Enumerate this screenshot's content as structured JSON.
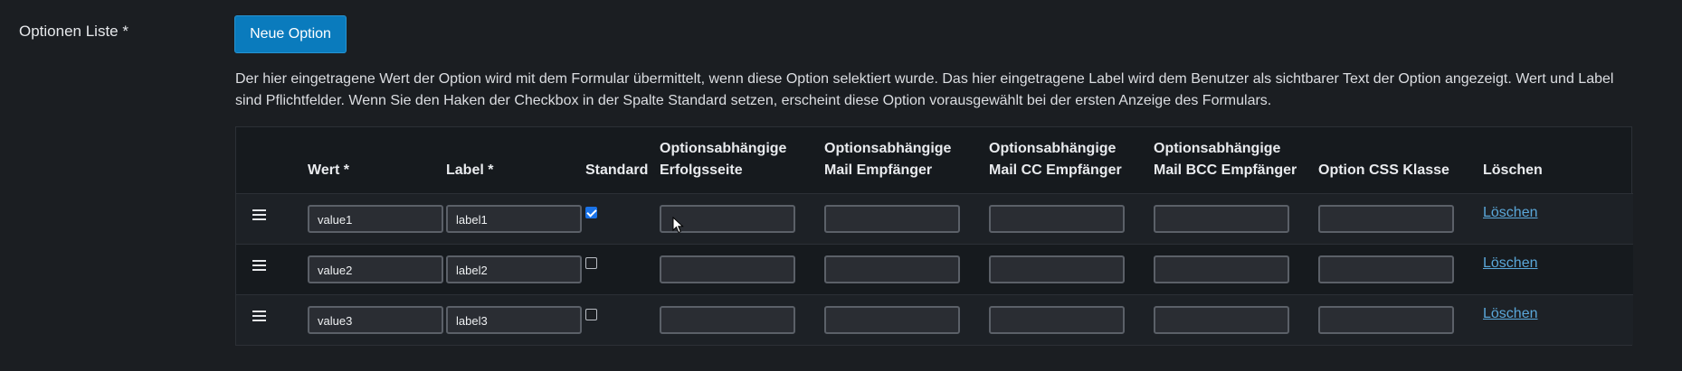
{
  "field": {
    "label": "Optionen Liste *",
    "new_button": "Neue Option",
    "description": "Der hier eingetragene Wert der Option wird mit dem Formular übermittelt, wenn diese Option selektiert wurde. Das hier eingetragene Label wird dem Benutzer als sichtbarer Text der Option angezeigt. Wert und Label sind Pflichtfelder. Wenn Sie den Haken der Checkbox in der Spalte Standard setzen, erscheint diese Option vorausgewählt bei der ersten Anzeige des Formulars."
  },
  "table": {
    "headers": {
      "wert": "Wert *",
      "label": "Label *",
      "standard": "Standard",
      "erfolg_1": "Optionsabhängige",
      "erfolg_2": "Erfolgsseite",
      "mail_1": "Optionsabhängige",
      "mail_2": "Mail Empfänger",
      "cc_1": "Optionsabhängige",
      "cc_2": "Mail CC Empfänger",
      "bcc_1": "Optionsabhängige",
      "bcc_2": "Mail BCC Empfänger",
      "css": "Option CSS Klasse",
      "loeschen": "Löschen"
    },
    "rows": [
      {
        "value": "value1",
        "label": "label1",
        "standard": true,
        "erfolgsseite": "",
        "mail": "",
        "mail_cc": "",
        "mail_bcc": "",
        "css": "",
        "delete": "Löschen"
      },
      {
        "value": "value2",
        "label": "label2",
        "standard": false,
        "erfolgsseite": "",
        "mail": "",
        "mail_cc": "",
        "mail_bcc": "",
        "css": "",
        "delete": "Löschen"
      },
      {
        "value": "value3",
        "label": "label3",
        "standard": false,
        "erfolgsseite": "",
        "mail": "",
        "mail_cc": "",
        "mail_bcc": "",
        "css": "",
        "delete": "Löschen"
      }
    ]
  },
  "icons": {
    "drag_handle": "drag-handle-icon",
    "pointer": "mouse-pointer-icon"
  },
  "colors": {
    "background": "#1b1e22",
    "primary_button": "#0a7bbd",
    "link": "#5aa7d9",
    "checkbox_checked": "#1a73e8"
  }
}
